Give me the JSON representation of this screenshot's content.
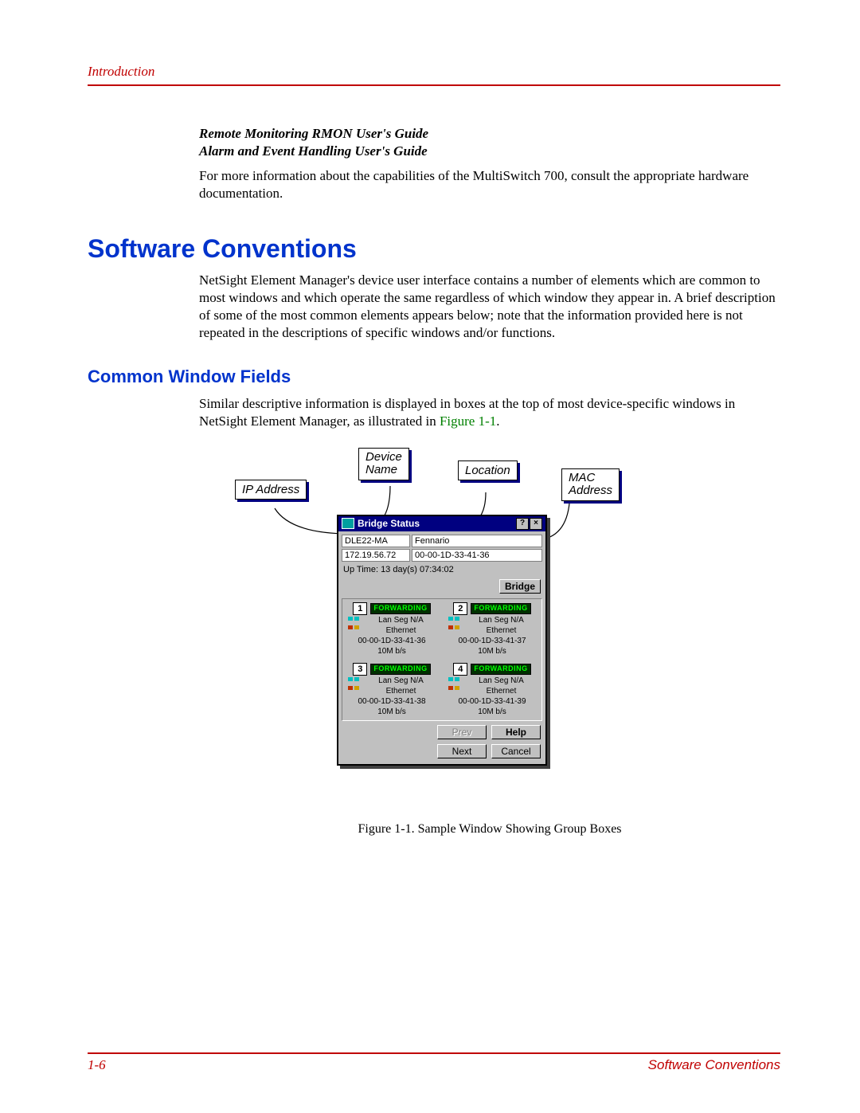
{
  "header": {
    "section": "Introduction"
  },
  "guides": {
    "rmon": "Remote Monitoring RMON User's Guide",
    "alarm": "Alarm and Event Handling User's Guide"
  },
  "intro_para": "For more information about the capabilities of the MultiSwitch 700, consult the appropriate hardware documentation.",
  "h1": "Software Conventions",
  "h1_para": "NetSight Element Manager's device user interface contains a number of elements which are common to most windows and which operate the same regardless of which window they appear in. A brief description of some of the most common elements appears below; note that the information provided here is not repeated in the descriptions of specific windows and/or functions.",
  "h2": "Common Window Fields",
  "h2_para_a": "Similar descriptive information is displayed in boxes at the top of most device-specific windows in NetSight Element Manager, as illustrated in ",
  "h2_para_link": "Figure 1-1",
  "h2_para_b": ".",
  "callouts": {
    "ip": "IP Address",
    "device": "Device Name",
    "location": "Location",
    "mac": "MAC Address"
  },
  "window": {
    "title": "Bridge Status",
    "help_btn": "?",
    "close_btn": "×",
    "device_name": "DLE22-MA",
    "location": "Fennario",
    "ip": "172.19.56.72",
    "mac": "00-00-1D-33-41-36",
    "uptime": "Up Time: 13 day(s) 07:34:02",
    "bridge_btn": "Bridge",
    "ports": [
      {
        "num": "1",
        "state": "FORWARDING",
        "seg": "Lan Seg N/A",
        "type": "Ethernet",
        "mac": "00-00-1D-33-41-36",
        "speed": "10M b/s"
      },
      {
        "num": "2",
        "state": "FORWARDING",
        "seg": "Lan Seg N/A",
        "type": "Ethernet",
        "mac": "00-00-1D-33-41-37",
        "speed": "10M b/s"
      },
      {
        "num": "3",
        "state": "FORWARDING",
        "seg": "Lan Seg N/A",
        "type": "Ethernet",
        "mac": "00-00-1D-33-41-38",
        "speed": "10M b/s"
      },
      {
        "num": "4",
        "state": "FORWARDING",
        "seg": "Lan Seg N/A",
        "type": "Ethernet",
        "mac": "00-00-1D-33-41-39",
        "speed": "10M b/s"
      }
    ],
    "buttons": {
      "prev": "Prev",
      "help": "Help",
      "next": "Next",
      "cancel": "Cancel"
    }
  },
  "figure_caption": "Figure 1-1. Sample Window Showing Group Boxes",
  "footer": {
    "page": "1-6",
    "section": "Software Conventions"
  }
}
